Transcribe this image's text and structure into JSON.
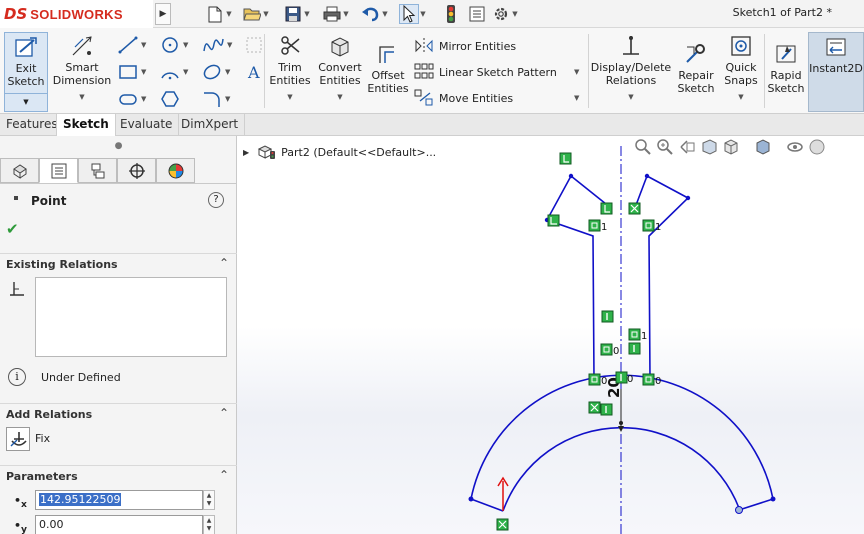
{
  "app": {
    "brand": "SOLIDWORKS",
    "brand_ds": "DS",
    "document_title": "Sketch1 of Part2 *"
  },
  "quick_access": {
    "icons": [
      "new-document-icon",
      "open-icon",
      "save-icon",
      "print-icon",
      "undo-icon",
      "select-icon",
      "rebuild-icon",
      "file-properties-icon",
      "options-icon"
    ]
  },
  "ribbon": {
    "exit_sketch": "Exit\nSketch",
    "smart_dimension": "Smart\nDimension",
    "trim_entities": "Trim\nEntities",
    "convert_entities": "Convert\nEntities",
    "offset_entities": "Offset\nEntities",
    "mirror_entities": "Mirror Entities",
    "linear_sketch_pattern": "Linear Sketch Pattern",
    "move_entities": "Move Entities",
    "display_delete_relations": "Display/Delete\nRelations",
    "repair_sketch": "Repair\nSketch",
    "quick_snaps": "Quick\nSnaps",
    "rapid_sketch": "Rapid\nSketch",
    "instant2d": "Instant2D"
  },
  "tabs": [
    "Features",
    "Sketch",
    "Evaluate",
    "DimXpert"
  ],
  "active_tab": "Sketch",
  "property_manager": {
    "title": "Point",
    "existing_relations_label": "Existing Relations",
    "status": "Under Defined",
    "add_relations_label": "Add Relations",
    "fix_label": "Fix",
    "parameters_label": "Parameters",
    "x_value": "142.95122509",
    "y_value": "0.00"
  },
  "feature_tree": {
    "node": "Part2  (Default<<Default>..."
  },
  "sketch": {
    "dimension_label": "20",
    "relation_numbers": [
      "1",
      "1",
      "1",
      "0",
      "0",
      "0",
      "0"
    ]
  },
  "colors": {
    "sketch_line": "#1010c8",
    "relation_badge": "#1fa33a",
    "axis_red": "#e01010",
    "accent": "#d52b1e"
  }
}
